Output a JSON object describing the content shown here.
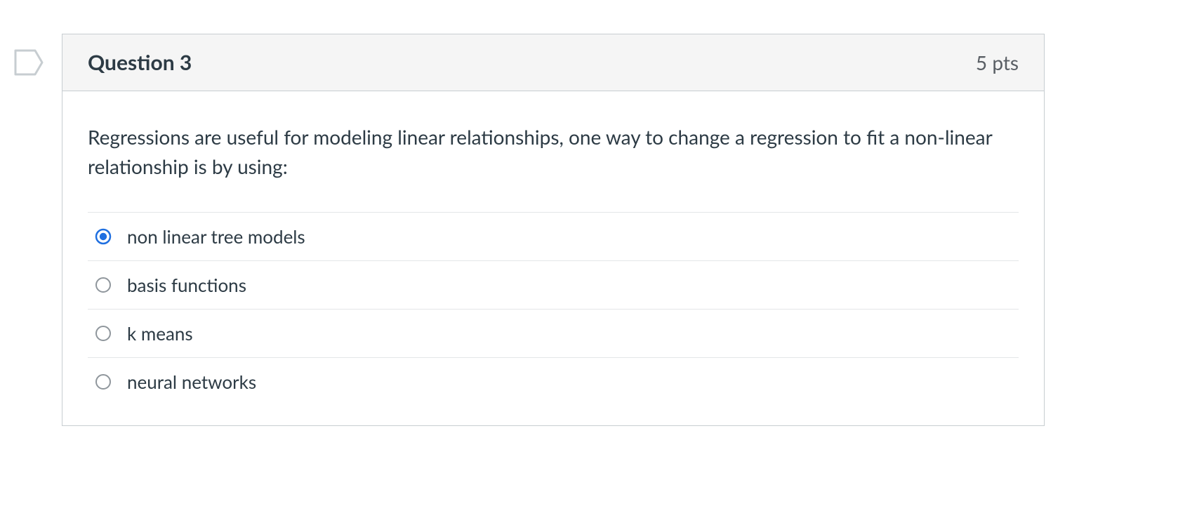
{
  "question": {
    "title": "Question 3",
    "points": "5 pts",
    "prompt": "Regressions are useful for modeling linear relationships, one way to change a regression to fit a non-linear relationship is by using:",
    "selected_index": 0,
    "options": [
      {
        "label": "non linear tree models"
      },
      {
        "label": "basis functions"
      },
      {
        "label": "k means"
      },
      {
        "label": "neural networks"
      }
    ]
  },
  "colors": {
    "selected": "#1f6fe0",
    "unselected": "#8f969c"
  }
}
